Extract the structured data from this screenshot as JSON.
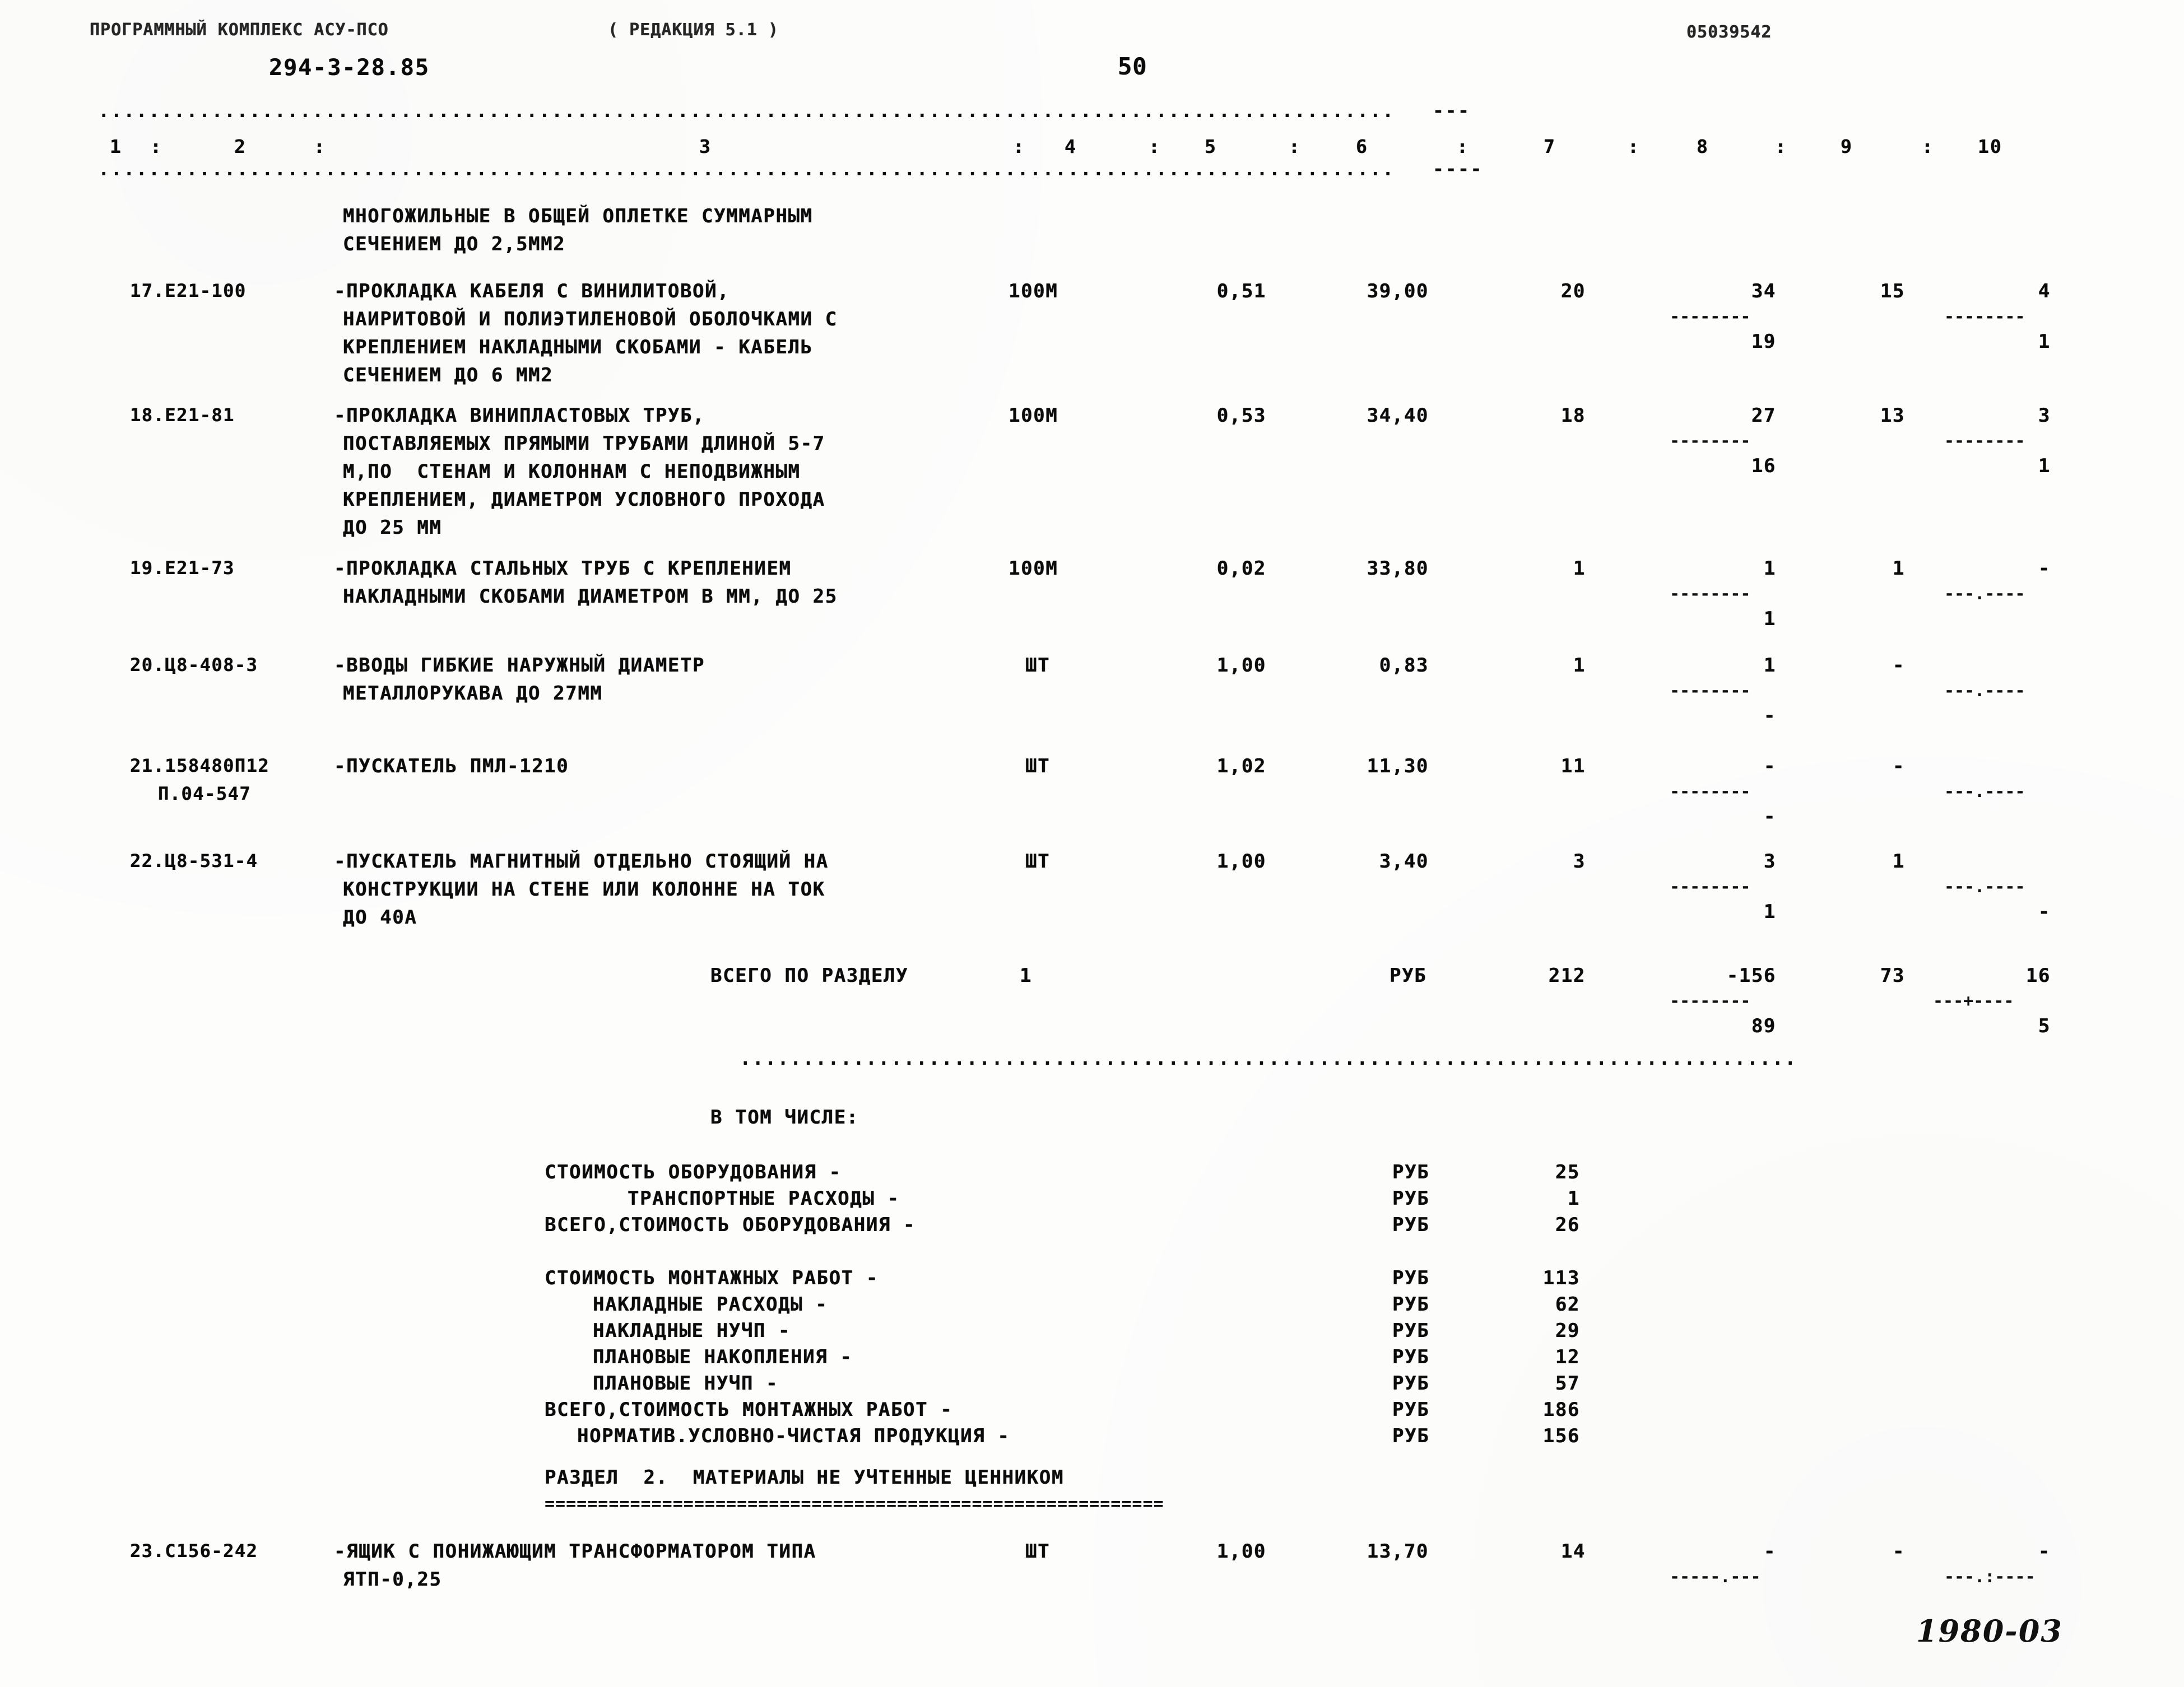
{
  "document": {
    "program_header": "ПРОГРАММНЫЙ КОМПЛЕКС АСУ-ПСО",
    "edition": "( РЕДАКЦИЯ 5.1 )",
    "doc_number": "294-3-28.85",
    "page_number": "50",
    "job_code": "05039542",
    "footer_stamp": "1980-03"
  },
  "table": {
    "column_headers": [
      "1",
      "2",
      "3",
      "4",
      "5",
      "6",
      "7",
      "8",
      "9",
      "10"
    ],
    "header_separators": [
      ":",
      ":",
      ":",
      ":",
      ":",
      ":",
      ":",
      ":",
      ":"
    ],
    "rule_top": ".......................................................................................................   ---",
    "rule_bottom": ".......................................................................................................   ----",
    "intro_lines": [
      "МНОГОЖИЛЬНЫЕ В ОБЩЕЙ ОПЛЕТКЕ СУММАРНЫМ",
      "СЕЧЕНИЕМ ДО 2,5ММ2"
    ],
    "rows": [
      {
        "code": "17.Е21-100",
        "desc": [
          "-ПРОКЛАДКА КАБЕЛЯ С ВИНИЛИТОВОЙ,",
          "НАИРИТОВОЙ И ПОЛИЭТИЛЕНОВОЙ ОБОЛОЧКАМИ С",
          "КРЕПЛЕНИЕМ НАКЛАДНЫМИ СКОБАМИ - КАБЕЛЬ",
          "СЕЧЕНИЕМ ДО 6 ММ2"
        ],
        "unit": "100М",
        "qty": "0,51",
        "price": "39,00",
        "c7": "20",
        "c8_top": "34",
        "c8_bot": "19",
        "c9": "15",
        "c10_top": "4",
        "c10_bot": "1"
      },
      {
        "code": "18.Е21-81",
        "desc": [
          "-ПРОКЛАДКА ВИНИПЛАСТОВЫХ ТРУБ,",
          "ПОСТАВЛЯЕМЫХ ПРЯМЫМИ ТРУБАМИ ДЛИНОЙ 5-7",
          "М,ПО  СТЕНАМ И КОЛОННАМ С НЕПОДВИЖНЫМ",
          "КРЕПЛЕНИЕМ, ДИАМЕТРОМ УСЛОВНОГО ПРОХОДА",
          "ДО 25 ММ"
        ],
        "unit": "100М",
        "qty": "0,53",
        "price": "34,40",
        "c7": "18",
        "c8_top": "27",
        "c8_bot": "16",
        "c9": "13",
        "c10_top": "3",
        "c10_bot": "1"
      },
      {
        "code": "19.Е21-73",
        "desc": [
          "-ПРОКЛАДКА СТАЛЬНЫХ ТРУБ С КРЕПЛЕНИЕМ",
          "НАКЛАДНЫМИ СКОБАМИ ДИАМЕТРОМ В ММ, ДО 25"
        ],
        "unit": "100М",
        "qty": "0,02",
        "price": "33,80",
        "c7": "1",
        "c8_top": "1",
        "c8_bot": "1",
        "c9": "1",
        "c10_top": "-",
        "c10_bot": "-"
      },
      {
        "code": "20.Ц8-408-3",
        "desc": [
          "-ВВОДЫ ГИБКИЕ НАРУЖНЫЙ ДИАМЕТР",
          "МЕТАЛЛОРУКАВА ДО 27ММ"
        ],
        "unit": "ШТ",
        "qty": "1,00",
        "price": "0,83",
        "c7": "1",
        "c8_top": "1",
        "c8_bot": "-",
        "c9": "-",
        "c10_top": "-",
        "c10_bot": "-"
      },
      {
        "code": "21.158480П12",
        "code2": "П.04-547",
        "desc": [
          "-ПУСКАТЕЛЬ ПМЛ-1210"
        ],
        "unit": "ШТ",
        "qty": "1,02",
        "price": "11,30",
        "c7": "11",
        "c8_top": "-",
        "c8_bot": "-",
        "c9": "-",
        "c10_top": "-",
        "c10_bot": "-"
      },
      {
        "code": "22.Ц8-531-4",
        "desc": [
          "-ПУСКАТЕЛЬ МАГНИТНЫЙ ОТДЕЛЬНО СТОЯЩИЙ НА",
          "КОНСТРУКЦИИ НА СТЕНЕ ИЛИ КОЛОННЕ НА ТОК",
          "ДО 40А"
        ],
        "unit": "ШТ",
        "qty": "1,00",
        "price": "3,40",
        "c7": "3",
        "c8_top": "3",
        "c8_bot": "1",
        "c9": "1",
        "c10_top": "-",
        "c10_bot": "-"
      }
    ],
    "section_total": {
      "label": "ВСЕГО ПО РАЗДЕЛУ",
      "section_no": "1",
      "unit": "РУБ",
      "c7": "212",
      "c8_top": "-156",
      "c8_bot": "89",
      "c9": "73",
      "c10_top": "16",
      "c10_bot": "5"
    },
    "total_rule": ".....................................................................................................-...."
  },
  "breakdown": {
    "heading": "В ТОМ ЧИСЛЕ:",
    "items": [
      {
        "label": "СТОИМОСТЬ ОБОРУДОВАНИЯ -",
        "unit": "РУБ",
        "value": "25",
        "indent": 0
      },
      {
        "label": "ТРАНСПОРТНЫЕ РАСХОДЫ -",
        "unit": "РУБ",
        "value": "1",
        "indent": 1
      },
      {
        "label": "ВСЕГО,СТОИМОСТЬ ОБОРУДОВАНИЯ -",
        "unit": "РУБ",
        "value": "26",
        "indent": 0
      },
      {
        "label": "СТОИМОСТЬ МОНТАЖНЫХ РАБОТ -",
        "unit": "РУБ",
        "value": "113",
        "indent": 0
      },
      {
        "label": "НАКЛАДНЫЕ РАСХОДЫ -",
        "unit": "РУБ",
        "value": "62",
        "indent": 1
      },
      {
        "label": "НАКЛАДНЫЕ НУЧП -",
        "unit": "РУБ",
        "value": "29",
        "indent": 1
      },
      {
        "label": "ПЛАНОВЫЕ НАКОПЛЕНИЯ -",
        "unit": "РУБ",
        "value": "12",
        "indent": 1
      },
      {
        "label": "ПЛАНОВЫЕ НУЧП -",
        "unit": "РУБ",
        "value": "57",
        "indent": 1
      },
      {
        "label": "ВСЕГО,СТОИМОСТЬ МОНТАЖНЫХ РАБОТ -",
        "unit": "РУБ",
        "value": "186",
        "indent": 0
      },
      {
        "label": "НОРМАТИВ.УСЛОВНО-ЧИСТАЯ ПРОДУКЦИЯ -",
        "unit": "РУБ",
        "value": "156",
        "indent": 1
      }
    ]
  },
  "section2": {
    "title": "РАЗДЕЛ  2.  МАТЕРИАЛЫ НЕ УЧТЕННЫЕ ЦЕННИКОМ",
    "underline": "==========================================================",
    "row": {
      "code": "23.С156-242",
      "desc": [
        "-ЯЩИК С ПОНИЖАЮЩИМ ТРАНСФОРМАТОРОМ ТИПА",
        "ЯТП-0,25"
      ],
      "unit": "ШТ",
      "qty": "1,00",
      "price": "13,70",
      "c7": "14",
      "c8_top": "-",
      "c8_bot": "",
      "c9": "-",
      "c10_top": "-",
      "c10_bot": "-"
    }
  }
}
